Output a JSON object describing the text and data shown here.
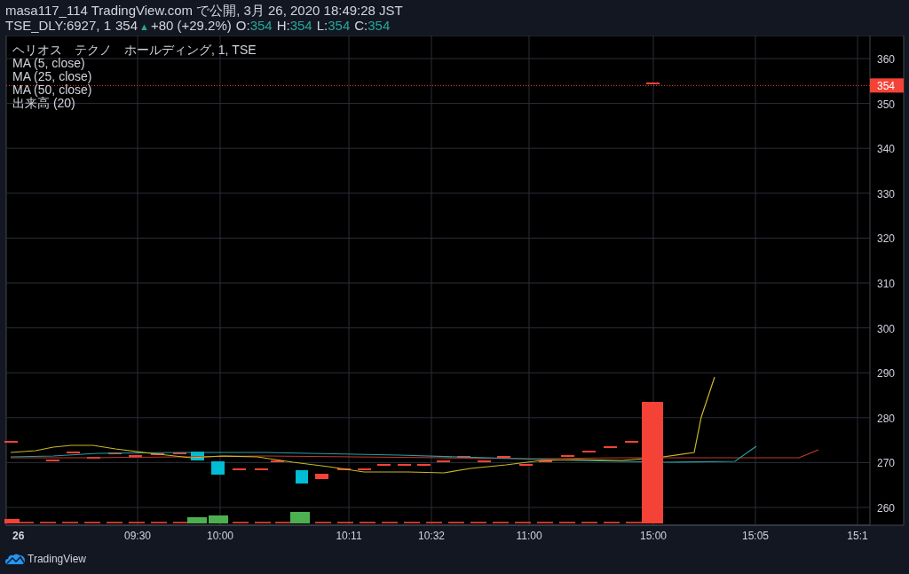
{
  "header": {
    "publish_line": "masa117_114 TradingView.com で公開, 3月 26, 2020 18:49:28 JST",
    "symbol": "TSE_DLY:6927, 1",
    "last": "354",
    "change_arrow": "▲",
    "change": "+80 (+29.2%)",
    "ohlc": [
      {
        "label": "O:",
        "value": "354"
      },
      {
        "label": "H:",
        "value": "354"
      },
      {
        "label": "L:",
        "value": "354"
      },
      {
        "label": "C:",
        "value": "354"
      }
    ]
  },
  "legend": [
    "ヘリオス　テクノ　ホールディング, 1, TSE",
    "MA (5, close)",
    "MA (25, close)",
    "MA (50, close)",
    "出来高 (20)"
  ],
  "price_axis": [
    "360",
    "350",
    "340",
    "330",
    "320",
    "310",
    "300",
    "290",
    "280",
    "270",
    "260"
  ],
  "price_tag": "354",
  "time_axis": [
    "26",
    "09:30",
    "10:00",
    "10:11",
    "10:32",
    "11:00",
    "15:00",
    "15:05",
    "15:1"
  ],
  "footer": {
    "logo_text": "TradingView"
  }
}
